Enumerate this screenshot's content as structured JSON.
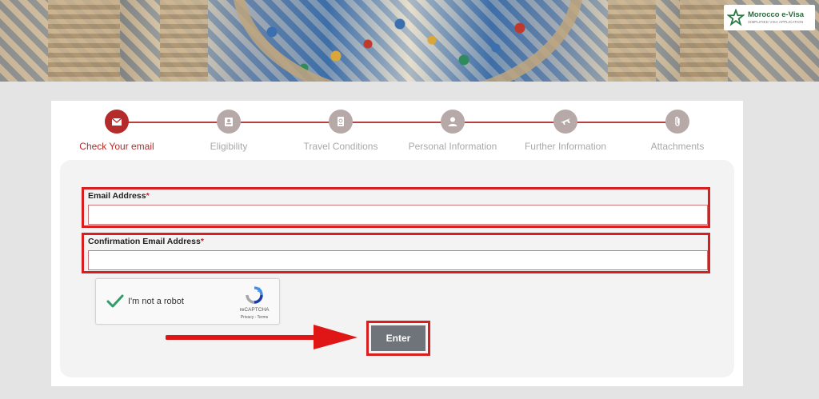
{
  "brand": {
    "title": "Morocco e-Visa",
    "subtitle": "SIMPLIFIED VISA APPLICATION",
    "logo_icon": "green-star-icon"
  },
  "steps": [
    {
      "label": "Check Your email",
      "icon": "envelope-icon",
      "active": true
    },
    {
      "label": "Eligibility",
      "icon": "id-card-icon",
      "active": false
    },
    {
      "label": "Travel Conditions",
      "icon": "passport-icon",
      "active": false
    },
    {
      "label": "Personal Information",
      "icon": "person-icon",
      "active": false
    },
    {
      "label": "Further Information",
      "icon": "plane-icon",
      "active": false
    },
    {
      "label": "Attachments",
      "icon": "paperclip-icon",
      "active": false
    }
  ],
  "form": {
    "email": {
      "label": "Email Address",
      "required_mark": "*",
      "value": ""
    },
    "confirm_email": {
      "label": "Confirmation Email Address",
      "required_mark": "*",
      "value": ""
    },
    "captcha": {
      "text": "I'm not a robot",
      "brand": "reCAPTCHA",
      "terms": "Privacy - Terms",
      "checked": true
    },
    "submit_label": "Enter"
  },
  "colors": {
    "accent": "#b52a2a",
    "highlight": "#d81e1e",
    "inactive_step": "#b8a9a9",
    "button": "#6f737a"
  }
}
